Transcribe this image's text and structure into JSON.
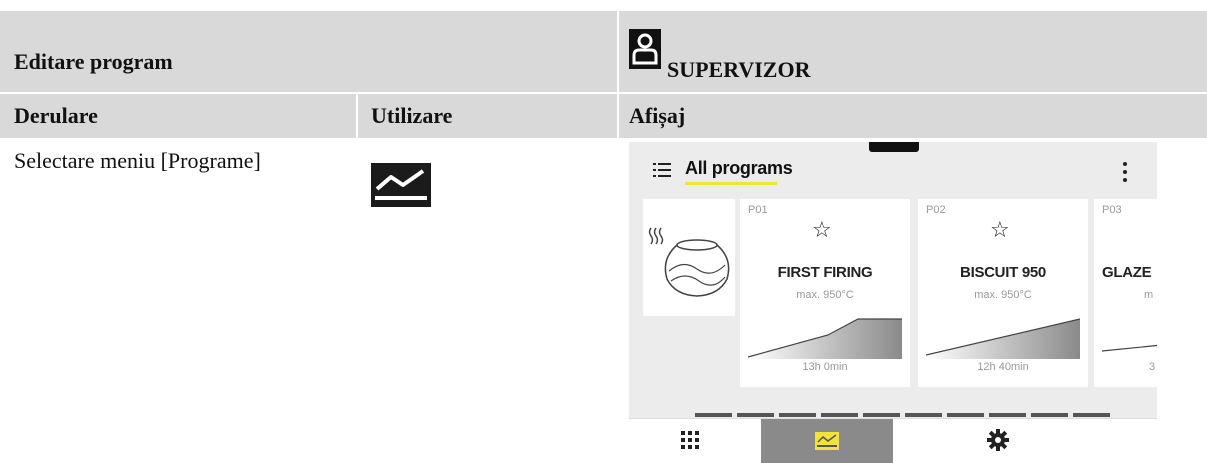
{
  "header": {
    "title": "Editare program",
    "role": "SUPERVIZOR"
  },
  "columns": {
    "col1": "Derulare",
    "col2": "Utilizare",
    "col3": "Afișaj"
  },
  "row1": {
    "step": "Selectare meniu [Programe]",
    "icon": "chart-icon"
  },
  "screen": {
    "title": "All programs",
    "programs": [
      {
        "code": "P01",
        "name": "FIRST FIRING",
        "max": "max. 950°C",
        "time": "13h 0min"
      },
      {
        "code": "P02",
        "name": "BISCUIT 950",
        "max": "max. 950°C",
        "time": "12h 40min"
      },
      {
        "code": "P03",
        "name": "GLAZE",
        "max": "m",
        "time": "3"
      }
    ],
    "pagination_pages": 10,
    "nav": [
      "grid-icon",
      "chart-icon",
      "gear-icon"
    ],
    "accent_color": "#f2e23a"
  }
}
